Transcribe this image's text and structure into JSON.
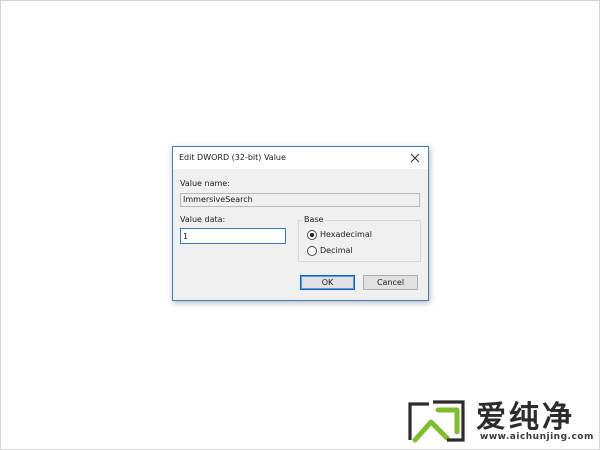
{
  "dialog": {
    "title": "Edit DWORD (32-bit) Value",
    "close_glyph": "✕",
    "value_name_label": "Value name:",
    "value_name": "ImmersiveSearch",
    "value_data_label": "Value data:",
    "value_data": "1",
    "base": {
      "legend": "Base",
      "options": [
        {
          "label": "Hexadecimal",
          "selected": true
        },
        {
          "label": "Decimal",
          "selected": false
        }
      ]
    },
    "buttons": {
      "ok": "OK",
      "cancel": "Cancel"
    }
  },
  "watermark": {
    "brand_text": "爱纯净",
    "url": "www.aichunjing.com",
    "colors": {
      "green": "#7cbf2a",
      "dark": "#2c2c2c"
    }
  },
  "colors": {
    "dialog_border": "#3f7fc9",
    "dialog_bg": "#f0f0f0",
    "input_focus_border": "#2f7ad0"
  }
}
